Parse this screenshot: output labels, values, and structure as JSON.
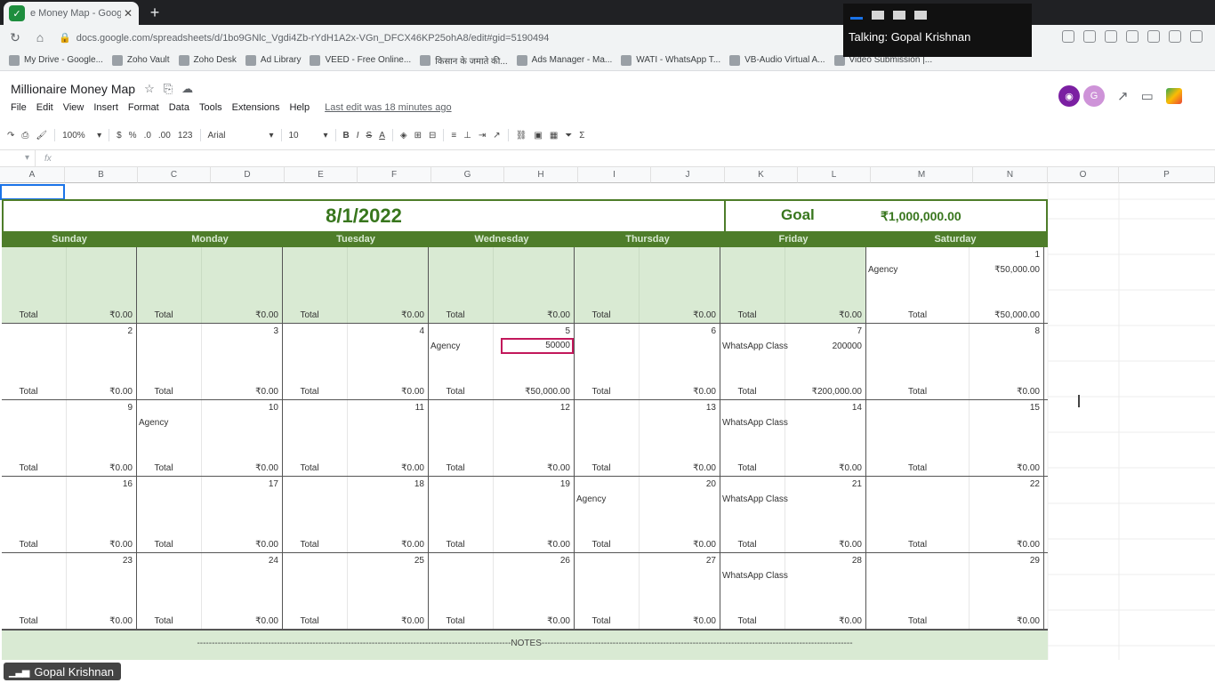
{
  "browser": {
    "tab_title": "e Money Map - Googl",
    "url": "docs.google.com/spreadsheets/d/1bo9GNlc_Vgdi4Zb-rYdH1A2x-VGn_DFCX46KP25ohA8/edit#gid=5190494",
    "bookmarks": [
      "My Drive - Google...",
      "Zoho Vault",
      "Zoho Desk",
      "Ad Library",
      "VEED - Free Online...",
      "किसान के जमाते की...",
      "Ads Manager - Ma...",
      "WATI - WhatsApp T...",
      "VB-Audio Virtual A...",
      "Video Submission |..."
    ]
  },
  "meeting": {
    "talking": "Talking: Gopal Krishnan",
    "participant": "Gopal Krishnan"
  },
  "doc": {
    "title": "Millionaire Money Map",
    "menu": [
      "File",
      "Edit",
      "View",
      "Insert",
      "Format",
      "Data",
      "Tools",
      "Extensions",
      "Help"
    ],
    "last_edit": "Last edit was 18 minutes ago",
    "avatar_g": "G",
    "toolbar": {
      "zoom": "100%",
      "currency": "$",
      "percent": "%",
      "dec": ".0",
      "dec2": ".00",
      "format123": "123",
      "font": "Arial",
      "size": "10",
      "bold": "B",
      "italic": "I",
      "strike": "S",
      "text_color": "A",
      "sigma": "Σ"
    },
    "formula_fx": "fx"
  },
  "columns": [
    "A",
    "B",
    "C",
    "D",
    "E",
    "F",
    "G",
    "H",
    "I",
    "J",
    "K",
    "L",
    "M",
    "N",
    "O",
    "P"
  ],
  "calendar": {
    "date": "8/1/2022",
    "goal_label": "Goal",
    "goal_value": "₹1,000,000.00",
    "days": [
      "Sunday",
      "Monday",
      "Tuesday",
      "Wednesday",
      "Thursday",
      "Friday",
      "Saturday"
    ],
    "total_label": "Total",
    "weeks": [
      [
        {
          "blank": true,
          "total": "₹0.00"
        },
        {
          "blank": true,
          "total": "₹0.00"
        },
        {
          "blank": true,
          "total": "₹0.00"
        },
        {
          "blank": true,
          "total": "₹0.00"
        },
        {
          "blank": true,
          "total": "₹0.00"
        },
        {
          "blank": true,
          "total": "₹0.00"
        },
        {
          "num": "1",
          "entry": "Agency",
          "entry_value": "₹50,000.00",
          "total": "₹50,000.00"
        }
      ],
      [
        {
          "num": "2",
          "total": "₹0.00"
        },
        {
          "num": "3",
          "total": "₹0.00"
        },
        {
          "num": "4",
          "total": "₹0.00"
        },
        {
          "num": "5",
          "entry": "Agency",
          "entry_value": "50000",
          "boxed": true,
          "total": "₹50,000.00"
        },
        {
          "num": "6",
          "total": "₹0.00"
        },
        {
          "num": "7",
          "entry": "WhatsApp Class",
          "entry_value": "200000",
          "total": "₹200,000.00"
        },
        {
          "num": "8",
          "total": "₹0.00"
        }
      ],
      [
        {
          "num": "9",
          "total": "₹0.00"
        },
        {
          "num": "10",
          "entry": "Agency",
          "total": "₹0.00"
        },
        {
          "num": "11",
          "total": "₹0.00"
        },
        {
          "num": "12",
          "total": "₹0.00"
        },
        {
          "num": "13",
          "total": "₹0.00"
        },
        {
          "num": "14",
          "entry": "WhatsApp Class",
          "total": "₹0.00"
        },
        {
          "num": "15",
          "total": "₹0.00"
        }
      ],
      [
        {
          "num": "16",
          "total": "₹0.00"
        },
        {
          "num": "17",
          "total": "₹0.00"
        },
        {
          "num": "18",
          "total": "₹0.00"
        },
        {
          "num": "19",
          "total": "₹0.00"
        },
        {
          "num": "20",
          "entry": "Agency",
          "total": "₹0.00"
        },
        {
          "num": "21",
          "entry": "WhatsApp Class",
          "total": "₹0.00"
        },
        {
          "num": "22",
          "total": "₹0.00"
        }
      ],
      [
        {
          "num": "23",
          "total": "₹0.00"
        },
        {
          "num": "24",
          "total": "₹0.00"
        },
        {
          "num": "25",
          "total": "₹0.00"
        },
        {
          "num": "26",
          "total": "₹0.00"
        },
        {
          "num": "27",
          "total": "₹0.00"
        },
        {
          "num": "28",
          "entry": "WhatsApp Class",
          "total": "₹0.00"
        },
        {
          "num": "29",
          "total": "₹0.00"
        }
      ]
    ],
    "notes": "----------------------------------------------------------------------------------------------------------NOTES---------------------------------------------------------------------------------------------------------"
  },
  "colors": {
    "header_green": "#4e7d2a",
    "light_green": "#d9ead3",
    "title_green": "#38761d",
    "selection_blue": "#1a73e8"
  }
}
